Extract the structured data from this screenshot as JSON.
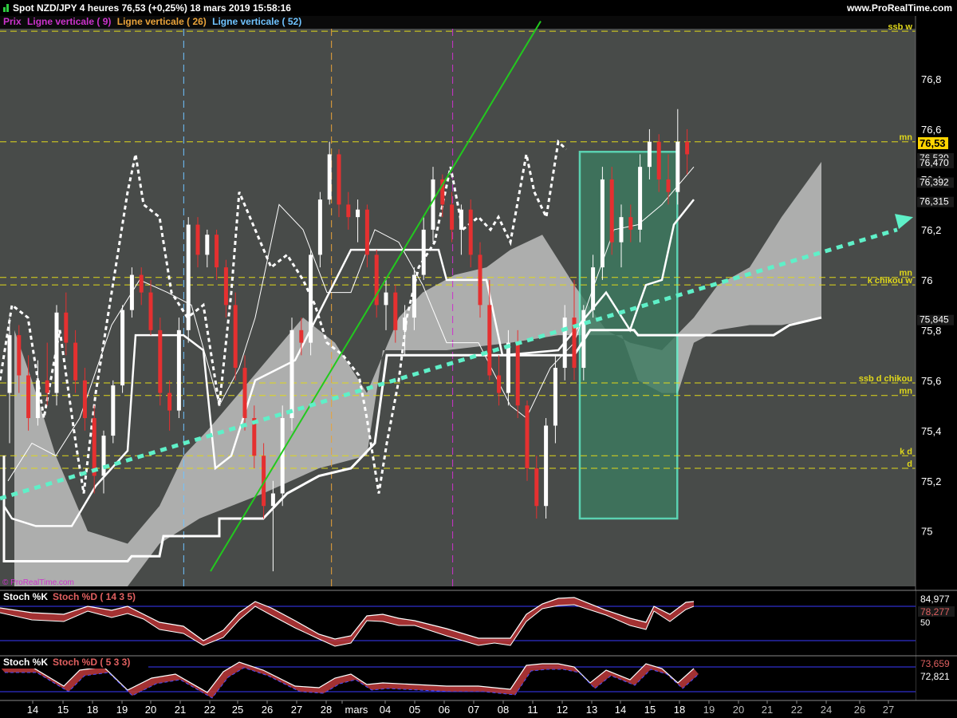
{
  "header": {
    "title": "Spot NZD/JPY   4 heures   76,53 (+0,25%)   18 mars 2019 15:58:16",
    "site": "www.ProRealTime.com",
    "watermark": "© ProRealTime.com"
  },
  "legend": [
    {
      "text": "Prix",
      "color": "#cc33cc"
    },
    {
      "text": "Ligne verticale ( 9)",
      "color": "#cc33cc"
    },
    {
      "text": "Ligne verticale ( 26)",
      "color": "#e8a23a"
    },
    {
      "text": "Ligne verticale ( 52)",
      "color": "#6fc3ff"
    }
  ],
  "colors": {
    "background": "#484b49",
    "box_fill": "#3c7a60",
    "box_stroke": "#5ff0c8",
    "up_candle": "#ffffff",
    "down_candle": "#e53030",
    "trend_green": "#22c91e",
    "trend_cyan": "#5ff0c8",
    "level_yellow": "#e0d81a",
    "price_badge": "#ffd400"
  },
  "chart_data": [
    {
      "type": "candlestick",
      "instrument": "Spot NZD/JPY",
      "timeframe": "4 heures",
      "last": 76.53,
      "change": "+0,25%",
      "ylim": [
        74.78,
        77.0
      ],
      "y_ticks": [
        "76,8",
        "76,6",
        "76,4",
        "76,2",
        "76",
        "75,8",
        "75,6",
        "75,4",
        "75,2",
        "75"
      ],
      "x_ticks": [
        "14",
        "15",
        "18",
        "19",
        "20",
        "21",
        "22",
        "25",
        "26",
        "27",
        "28",
        "mars",
        "04",
        "05",
        "06",
        "07",
        "08",
        "11",
        "12",
        "13",
        "14",
        "15",
        "18",
        "19",
        "20",
        "21",
        "22",
        "24",
        "26",
        "27"
      ],
      "price_labels": [
        {
          "value": 76.53,
          "text": "76,53",
          "badge": true
        },
        {
          "value": 76.53,
          "text": "76,530"
        },
        {
          "value": 76.47,
          "text": "76,470"
        },
        {
          "value": 76.392,
          "text": "76,392"
        },
        {
          "value": 76.315,
          "text": "76,315"
        },
        {
          "value": 75.845,
          "text": "75,845"
        }
      ],
      "levels": [
        {
          "name": "ssb w",
          "value": 76.99
        },
        {
          "name": "mn",
          "value": 76.55
        },
        {
          "name": "mn",
          "value": 76.01
        },
        {
          "name": "k chikou w",
          "value": 75.98
        },
        {
          "name": "ssb d chikou",
          "value": 75.59
        },
        {
          "name": "mn",
          "value": 75.54
        },
        {
          "name": "k d",
          "value": 75.3
        },
        {
          "name": "d",
          "value": 75.25
        }
      ],
      "box": {
        "x_from": 19.4,
        "x_to": 22.7,
        "y_from": 75.05,
        "y_to": 76.51
      },
      "vertical_lines": [
        {
          "x": 6.0,
          "color": "#6fc3ff"
        },
        {
          "x": 11.0,
          "color": "#e8a23a"
        },
        {
          "x": 15.1,
          "color": "#cc33cc"
        }
      ],
      "trend_lines": [
        {
          "name": "green",
          "from": [
            22.0,
            74.84
          ],
          "to": [
            11.0,
            77.03
          ]
        },
        {
          "name": "cyan-dotted",
          "from": [
            12.0,
            75.13
          ],
          "to": [
            30.0,
            76.25
          ]
        }
      ],
      "candles": [
        {
          "x": 0,
          "o": 75.55,
          "h": 75.85,
          "l": 75.35,
          "c": 75.78
        },
        {
          "x": 1,
          "o": 75.78,
          "h": 75.82,
          "l": 75.55,
          "c": 75.62
        },
        {
          "x": 2,
          "o": 75.62,
          "h": 75.7,
          "l": 75.4,
          "c": 75.45
        },
        {
          "x": 3,
          "o": 75.45,
          "h": 75.68,
          "l": 75.42,
          "c": 75.6
        },
        {
          "x": 4,
          "o": 75.6,
          "h": 75.75,
          "l": 75.5,
          "c": 75.55
        },
        {
          "x": 5,
          "o": 75.55,
          "h": 75.9,
          "l": 75.5,
          "c": 75.87
        },
        {
          "x": 6,
          "o": 75.87,
          "h": 75.95,
          "l": 75.7,
          "c": 75.75
        },
        {
          "x": 7,
          "o": 75.75,
          "h": 75.8,
          "l": 75.55,
          "c": 75.6
        },
        {
          "x": 8,
          "o": 75.6,
          "h": 75.65,
          "l": 75.4,
          "c": 75.45
        },
        {
          "x": 9,
          "o": 75.45,
          "h": 75.5,
          "l": 75.15,
          "c": 75.22
        },
        {
          "x": 10,
          "o": 75.22,
          "h": 75.4,
          "l": 75.15,
          "c": 75.38
        },
        {
          "x": 11,
          "o": 75.38,
          "h": 75.6,
          "l": 75.35,
          "c": 75.58
        },
        {
          "x": 12,
          "o": 75.58,
          "h": 75.9,
          "l": 75.55,
          "c": 75.88
        },
        {
          "x": 13,
          "o": 75.88,
          "h": 76.05,
          "l": 75.85,
          "c": 76.02
        },
        {
          "x": 14,
          "o": 76.02,
          "h": 76.05,
          "l": 75.9,
          "c": 75.95
        },
        {
          "x": 15,
          "o": 75.95,
          "h": 76.0,
          "l": 75.78,
          "c": 75.8
        },
        {
          "x": 16,
          "o": 75.8,
          "h": 75.85,
          "l": 75.5,
          "c": 75.55
        },
        {
          "x": 17,
          "o": 75.55,
          "h": 75.6,
          "l": 75.4,
          "c": 75.48
        },
        {
          "x": 18,
          "o": 75.48,
          "h": 75.85,
          "l": 75.45,
          "c": 75.8
        },
        {
          "x": 19,
          "o": 75.8,
          "h": 76.25,
          "l": 75.75,
          "c": 76.22
        },
        {
          "x": 20,
          "o": 76.22,
          "h": 76.25,
          "l": 76.05,
          "c": 76.1
        },
        {
          "x": 21,
          "o": 76.1,
          "h": 76.2,
          "l": 76.05,
          "c": 76.18
        },
        {
          "x": 22,
          "o": 76.18,
          "h": 76.2,
          "l": 76.0,
          "c": 76.05
        },
        {
          "x": 23,
          "o": 76.05,
          "h": 76.08,
          "l": 75.85,
          "c": 75.9
        },
        {
          "x": 24,
          "o": 75.9,
          "h": 75.95,
          "l": 75.6,
          "c": 75.65
        },
        {
          "x": 25,
          "o": 75.65,
          "h": 75.7,
          "l": 75.4,
          "c": 75.45
        },
        {
          "x": 26,
          "o": 75.45,
          "h": 75.5,
          "l": 75.25,
          "c": 75.3
        },
        {
          "x": 27,
          "o": 75.3,
          "h": 75.35,
          "l": 75.05,
          "c": 75.1
        },
        {
          "x": 28,
          "o": 75.1,
          "h": 75.2,
          "l": 74.84,
          "c": 75.15
        },
        {
          "x": 29,
          "o": 75.15,
          "h": 75.5,
          "l": 75.1,
          "c": 75.45
        },
        {
          "x": 30,
          "o": 75.45,
          "h": 75.85,
          "l": 75.4,
          "c": 75.8
        },
        {
          "x": 31,
          "o": 75.8,
          "h": 75.85,
          "l": 75.7,
          "c": 75.75
        },
        {
          "x": 32,
          "o": 75.75,
          "h": 76.12,
          "l": 75.7,
          "c": 76.1
        },
        {
          "x": 33,
          "o": 76.1,
          "h": 76.35,
          "l": 76.05,
          "c": 76.32
        },
        {
          "x": 34,
          "o": 76.32,
          "h": 76.55,
          "l": 76.3,
          "c": 76.5
        },
        {
          "x": 35,
          "o": 76.5,
          "h": 76.52,
          "l": 76.25,
          "c": 76.3
        },
        {
          "x": 36,
          "o": 76.3,
          "h": 76.35,
          "l": 76.2,
          "c": 76.25
        },
        {
          "x": 37,
          "o": 76.25,
          "h": 76.32,
          "l": 76.15,
          "c": 76.28
        },
        {
          "x": 38,
          "o": 76.28,
          "h": 76.3,
          "l": 76.05,
          "c": 76.1
        },
        {
          "x": 39,
          "o": 76.1,
          "h": 76.12,
          "l": 75.85,
          "c": 75.9
        },
        {
          "x": 40,
          "o": 75.9,
          "h": 76.0,
          "l": 75.8,
          "c": 75.95
        },
        {
          "x": 41,
          "o": 75.95,
          "h": 75.98,
          "l": 75.75,
          "c": 75.8
        },
        {
          "x": 42,
          "o": 75.8,
          "h": 75.9,
          "l": 75.7,
          "c": 75.85
        },
        {
          "x": 43,
          "o": 75.85,
          "h": 76.05,
          "l": 75.8,
          "c": 76.02
        },
        {
          "x": 44,
          "o": 76.02,
          "h": 76.25,
          "l": 76.0,
          "c": 76.2
        },
        {
          "x": 45,
          "o": 76.2,
          "h": 76.45,
          "l": 76.15,
          "c": 76.4
        },
        {
          "x": 46,
          "o": 76.4,
          "h": 76.42,
          "l": 76.25,
          "c": 76.3
        },
        {
          "x": 47,
          "o": 76.3,
          "h": 76.35,
          "l": 76.15,
          "c": 76.2
        },
        {
          "x": 48,
          "o": 76.2,
          "h": 76.3,
          "l": 76.1,
          "c": 76.28
        },
        {
          "x": 49,
          "o": 76.28,
          "h": 76.32,
          "l": 76.05,
          "c": 76.1
        },
        {
          "x": 50,
          "o": 76.1,
          "h": 76.15,
          "l": 75.85,
          "c": 75.9
        },
        {
          "x": 51,
          "o": 75.9,
          "h": 76.0,
          "l": 75.6,
          "c": 75.62
        },
        {
          "x": 52,
          "o": 75.62,
          "h": 75.7,
          "l": 75.5,
          "c": 75.55
        },
        {
          "x": 53,
          "o": 75.55,
          "h": 75.8,
          "l": 75.5,
          "c": 75.75
        },
        {
          "x": 54,
          "o": 75.75,
          "h": 75.8,
          "l": 75.45,
          "c": 75.5
        },
        {
          "x": 55,
          "o": 75.5,
          "h": 75.52,
          "l": 75.2,
          "c": 75.25
        },
        {
          "x": 56,
          "o": 75.25,
          "h": 75.3,
          "l": 75.05,
          "c": 75.1
        },
        {
          "x": 57,
          "o": 75.1,
          "h": 75.45,
          "l": 75.05,
          "c": 75.42
        },
        {
          "x": 58,
          "o": 75.42,
          "h": 75.7,
          "l": 75.35,
          "c": 75.65
        },
        {
          "x": 59,
          "o": 75.65,
          "h": 75.9,
          "l": 75.6,
          "c": 75.85
        },
        {
          "x": 60,
          "o": 75.85,
          "h": 76.0,
          "l": 75.6,
          "c": 75.65
        },
        {
          "x": 61,
          "o": 75.65,
          "h": 75.9,
          "l": 75.6,
          "c": 75.88
        },
        {
          "x": 62,
          "o": 75.88,
          "h": 76.1,
          "l": 75.85,
          "c": 76.05
        },
        {
          "x": 63,
          "o": 76.05,
          "h": 76.45,
          "l": 76.0,
          "c": 76.4
        },
        {
          "x": 64,
          "o": 76.4,
          "h": 76.45,
          "l": 76.1,
          "c": 76.15
        },
        {
          "x": 65,
          "o": 76.15,
          "h": 76.3,
          "l": 76.05,
          "c": 76.25
        },
        {
          "x": 66,
          "o": 76.25,
          "h": 76.3,
          "l": 76.15,
          "c": 76.2
        },
        {
          "x": 67,
          "o": 76.2,
          "h": 76.5,
          "l": 76.15,
          "c": 76.45
        },
        {
          "x": 68,
          "o": 76.45,
          "h": 76.6,
          "l": 76.4,
          "c": 76.55
        },
        {
          "x": 69,
          "o": 76.55,
          "h": 76.58,
          "l": 76.35,
          "c": 76.4
        },
        {
          "x": 70,
          "o": 76.4,
          "h": 76.5,
          "l": 76.3,
          "c": 76.35
        },
        {
          "x": 71,
          "o": 76.35,
          "h": 76.68,
          "l": 76.3,
          "c": 76.55
        },
        {
          "x": 72,
          "o": 76.55,
          "h": 76.6,
          "l": 76.42,
          "c": 76.5
        }
      ]
    },
    {
      "type": "line",
      "name": "Stoch %K / Stoch %D ( 14 3 5)",
      "ticks": [
        "50"
      ],
      "labels": [
        {
          "value": 84.977,
          "text": "84,977"
        },
        {
          "value": 78.277,
          "text": "78,277"
        }
      ]
    },
    {
      "type": "line",
      "name": "Stoch %K / Stoch %D ( 5 3 3)",
      "labels": [
        {
          "value": 73.659,
          "text": "73,659"
        },
        {
          "value": 72.821,
          "text": "72,821"
        }
      ]
    }
  ],
  "sub1": {
    "k": "Stoch %K",
    "d": "Stoch %D ( 14 3 5)"
  },
  "sub2": {
    "k": "Stoch %K",
    "d": "Stoch %D ( 5 3 3)"
  }
}
